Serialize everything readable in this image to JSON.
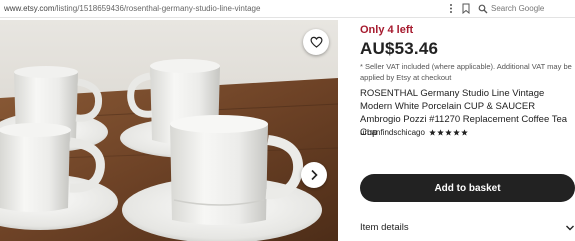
{
  "browser": {
    "url_domain": "www.etsy.com",
    "url_path": "/listing/1518659436/rosenthal-germany-studio-line-vintage",
    "search_placeholder": "Search Google",
    "icons": [
      "more-icon",
      "bookmark-icon",
      "search-icon"
    ]
  },
  "gallery": {
    "favorite_icon": "heart-icon",
    "next_icon": "chevron-right-icon"
  },
  "listing": {
    "stock_notice": "Only 4 left",
    "price": "AU$53.46",
    "vat_note": "* Seller VAT included (where applicable). Additional VAT may be applied by Etsy at checkout",
    "title": "ROSENTHAL Germany Studio Line Vintage Modern White Porcelain CUP & SAUCER Ambrogio Pozzi #11270 Replacement Coffee Tea Cup",
    "shop_name": "urbanfindschicago",
    "rating_stars": 5,
    "add_to_basket_label": "Add to basket",
    "item_details_label": "Item details",
    "item_details_icon": "chevron-down-icon"
  },
  "colors": {
    "stock_red": "#a61a2e",
    "button_dark": "#222222"
  }
}
